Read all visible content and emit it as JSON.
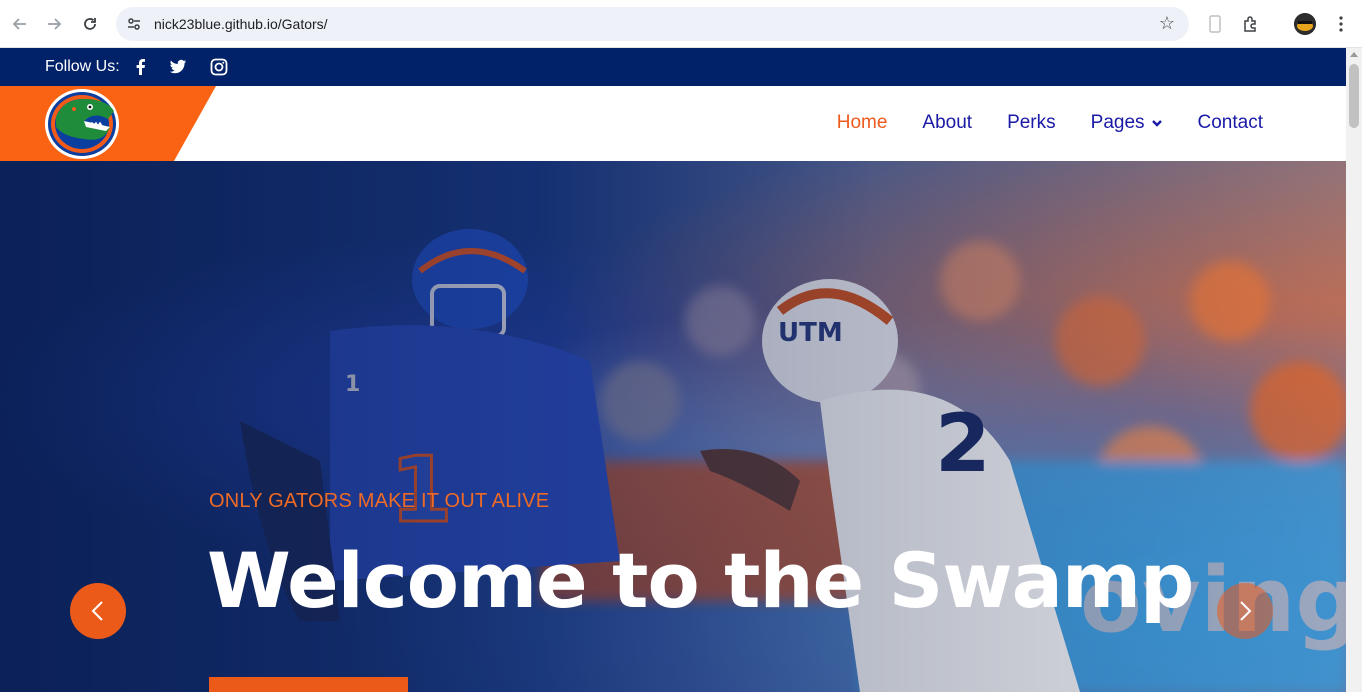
{
  "browser": {
    "url": "nick23blue.github.io/Gators/",
    "icons": [
      "back-arrow-icon",
      "forward-arrow-icon",
      "reload-icon",
      "site-settings-icon",
      "bookmark-star-icon",
      "phone-icon",
      "extensions-icon",
      "profile-avatar",
      "more-menu-icon"
    ]
  },
  "topbar": {
    "follow_label": "Follow Us:",
    "social": [
      "facebook-icon",
      "twitter-icon",
      "instagram-icon"
    ]
  },
  "nav": {
    "links": [
      {
        "label": "Home",
        "active": true
      },
      {
        "label": "About",
        "active": false
      },
      {
        "label": "Perks",
        "active": false
      },
      {
        "label": "Pages",
        "active": false,
        "has_dropdown": true
      },
      {
        "label": "Contact",
        "active": false
      }
    ]
  },
  "hero": {
    "kicker": "ONLY GATORS MAKE IT OUT ALIVE",
    "headline": "Welcome to the Swamp"
  },
  "colors": {
    "navy": "#012169",
    "orange": "#ec5a1a",
    "link_blue": "#1a1aa6"
  }
}
